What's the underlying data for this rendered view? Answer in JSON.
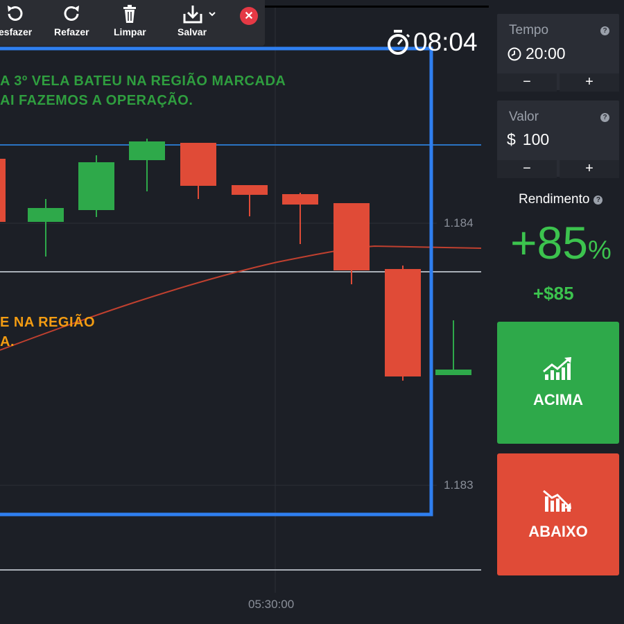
{
  "toolbar": {
    "undo_label": "esfazer",
    "redo_label": "Refazer",
    "clear_label": "Limpar",
    "save_label": "Salvar"
  },
  "clock": {
    "time": "08:04"
  },
  "chart": {
    "annotation_green_1": "A 3º VELA BATEU NA REGIÃO MARCADA",
    "annotation_green_2": "AI FAZEMOS A OPERAÇÃO.",
    "annotation_orange_1": "E NA REGIÃO",
    "annotation_orange_2": "A.",
    "price_high": "1.184",
    "price_low": "1.183",
    "time_label": "05:30:00",
    "colors": {
      "up": "#2ea94a",
      "down": "#e04b37",
      "highlight_box": "#2f7ff0",
      "ma_line": "#c0402f"
    }
  },
  "panel": {
    "time_label": "Tempo",
    "time_value": "20:00",
    "value_label": "Valor",
    "currency": "$",
    "value_amount": "100",
    "minus": "−",
    "plus": "+",
    "yield_label": "Rendimento",
    "yield_percent": "+85",
    "percent_sign": "%",
    "yield_amount": "+$85",
    "up_button": "ACIMA",
    "down_button": "ABAIXO",
    "help": "?"
  }
}
